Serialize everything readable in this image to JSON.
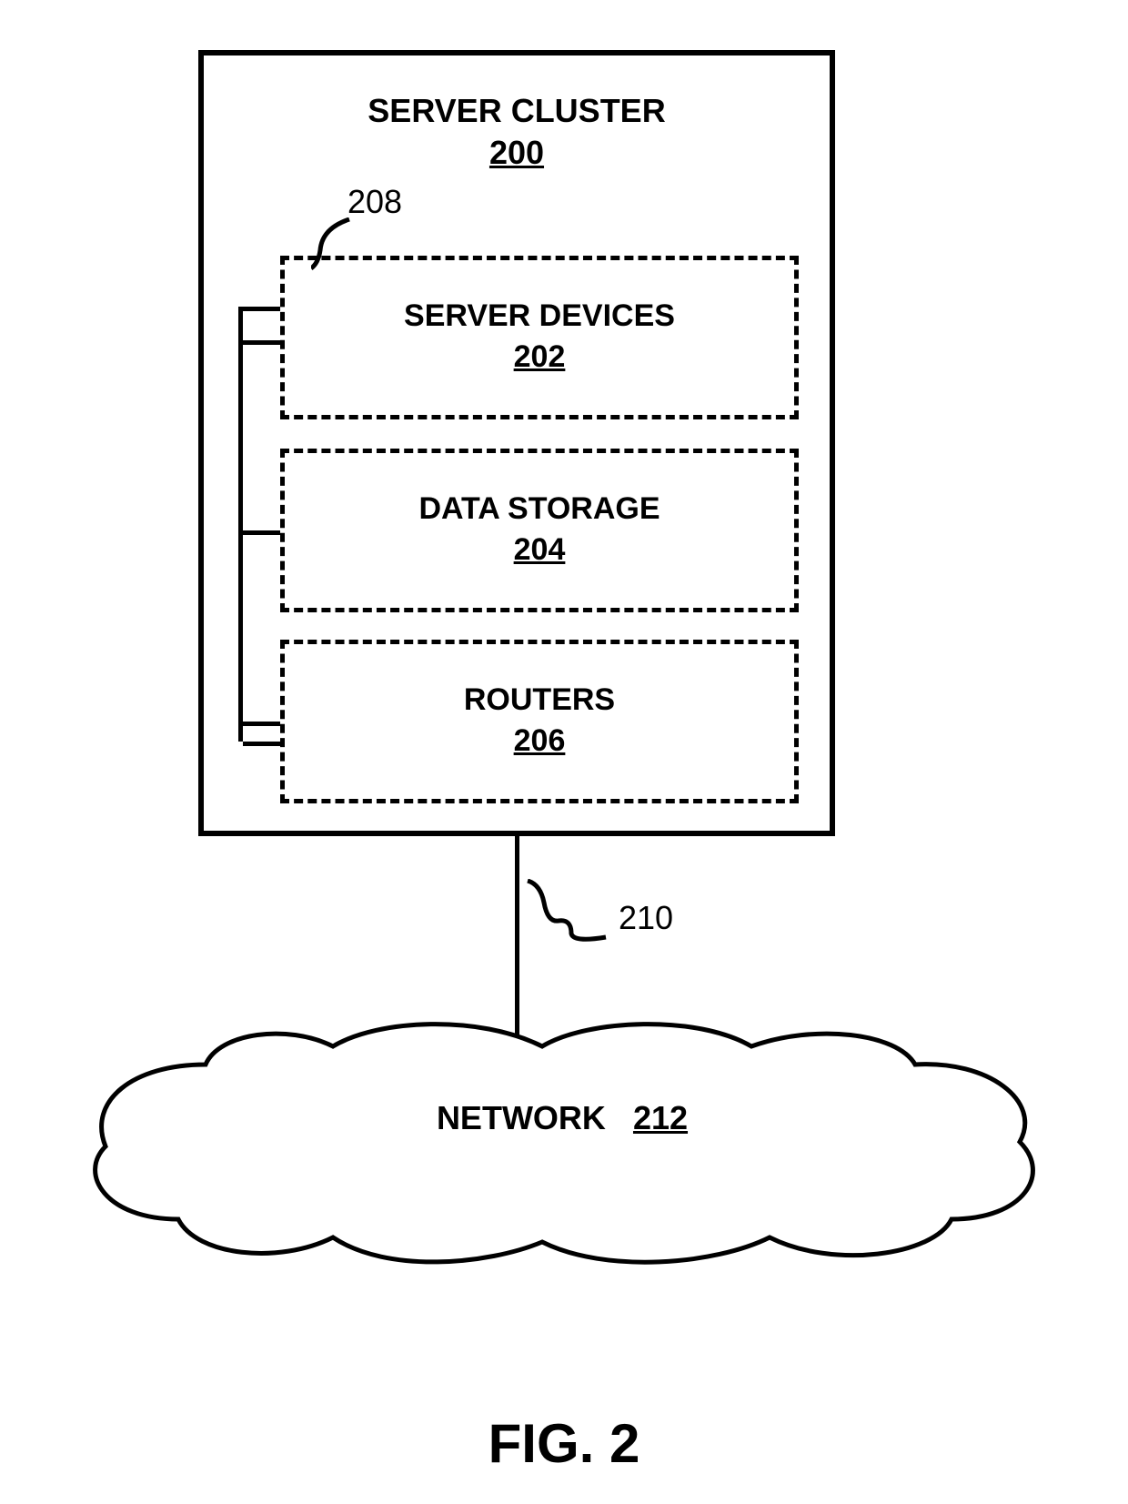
{
  "cluster": {
    "title": "SERVER CLUSTER",
    "ref": "200",
    "bus_ref": "208"
  },
  "boxes": [
    {
      "title": "SERVER DEVICES",
      "ref": "202"
    },
    {
      "title": "DATA STORAGE",
      "ref": "204"
    },
    {
      "title": "ROUTERS",
      "ref": "206"
    }
  ],
  "connection": {
    "ref": "210"
  },
  "network": {
    "label": "NETWORK",
    "ref": "212"
  },
  "figure": "FIG. 2"
}
